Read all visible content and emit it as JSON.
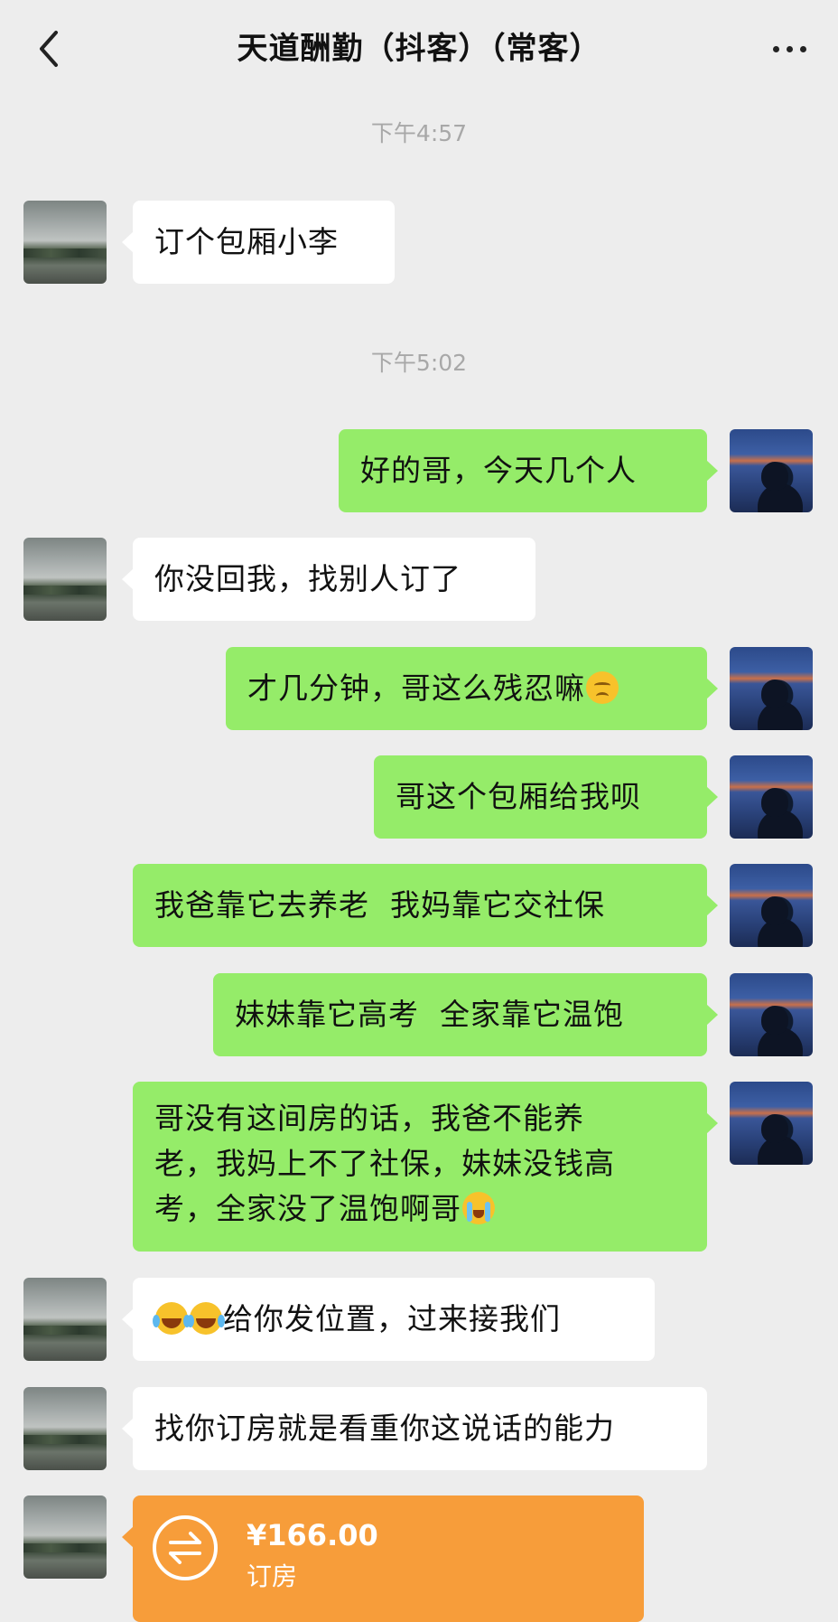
{
  "header": {
    "title": "天道酬勤（抖客）（常客）"
  },
  "timestamps": [
    "下午4:57",
    "下午5:02"
  ],
  "messages": [
    {
      "side": "left",
      "text": "订个包厢小李"
    },
    {
      "side": "right",
      "text": "好的哥，今天几个人"
    },
    {
      "side": "left",
      "text": "你没回我，找别人订了"
    },
    {
      "side": "right",
      "text": "才几分钟，哥这么残忍嘛",
      "emoji": "frown-emoji"
    },
    {
      "side": "right",
      "text": "哥这个包厢给我呗"
    },
    {
      "side": "right",
      "text": "我爸靠它去养老  我妈靠它交社保"
    },
    {
      "side": "right",
      "text": "妹妹靠它高考  全家靠它温饱"
    },
    {
      "side": "right",
      "lines": [
        "哥没有这间房的话，我爸不能养",
        "老，我妈上不了社保，妹妹没钱高",
        "考，全家没了温饱啊哥"
      ],
      "emoji": "crying-emoji"
    },
    {
      "side": "left",
      "text": "给你发位置，过来接我们",
      "emoji": "tears-of-joy-emoji"
    },
    {
      "side": "left",
      "text": "找你订房就是看重你这说话的能力"
    }
  ],
  "transfer": {
    "amount": "¥166.00",
    "label": "订房",
    "color": "#f79d3a"
  },
  "colors": {
    "background": "#ededed",
    "outgoing_bubble": "#95ec69",
    "incoming_bubble": "#ffffff"
  }
}
